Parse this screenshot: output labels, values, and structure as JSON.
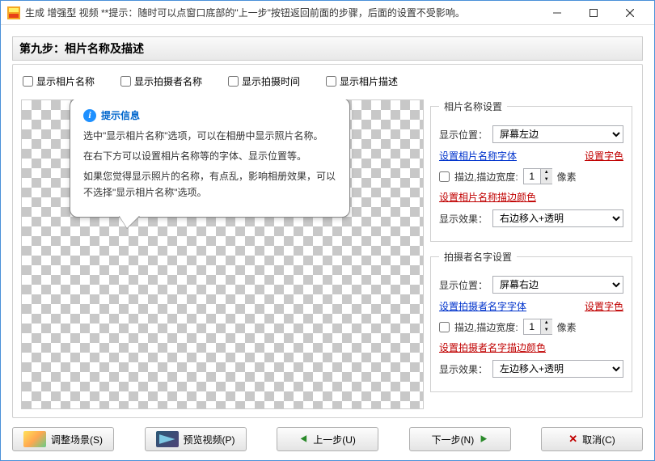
{
  "titlebar": {
    "text": "生成 增强型 视频  **提示：随时可以点窗口底部的\"上一步\"按钮返回前面的步骤，后面的设置不受影响。"
  },
  "step_header": "第九步：相片名称及描述",
  "checkboxes": {
    "show_name": "显示相片名称",
    "show_author": "显示拍摄者名称",
    "show_time": "显示拍摄时间",
    "show_desc": "显示相片描述"
  },
  "tooltip": {
    "title": "提示信息",
    "p1": "选中\"显示相片名称\"选项，可以在相册中显示照片名称。",
    "p2": "在右下方可以设置相片名称等的字体、显示位置等。",
    "p3": "如果您觉得显示照片的名称，有点乱，影响相册效果，可以不选择\"显示相片名称\"选项。"
  },
  "name_settings": {
    "legend": "相片名称设置",
    "pos_label": "显示位置：",
    "pos_value": "屏幕左边",
    "font_link": "设置相片名称字体",
    "color_link": "设置字色",
    "border_cb": "描边,描边宽度:",
    "border_val": "1",
    "border_unit": "像素",
    "border_color_link": "设置相片名称描边颜色",
    "effect_label": "显示效果：",
    "effect_value": "右边移入+透明"
  },
  "author_settings": {
    "legend": "拍摄者名字设置",
    "pos_label": "显示位置：",
    "pos_value": "屏幕右边",
    "font_link": "设置拍摄者名字字体",
    "color_link": "设置字色",
    "border_cb": "描边,描边宽度:",
    "border_val": "1",
    "border_unit": "像素",
    "border_color_link": "设置拍摄者名字描边颜色",
    "effect_label": "显示效果：",
    "effect_value": "左边移入+透明"
  },
  "footer": {
    "scene": "调整场景(S)",
    "preview": "预览视频(P)",
    "prev": "上一步(U)",
    "next": "下一步(N)",
    "cancel": "取消(C)"
  }
}
